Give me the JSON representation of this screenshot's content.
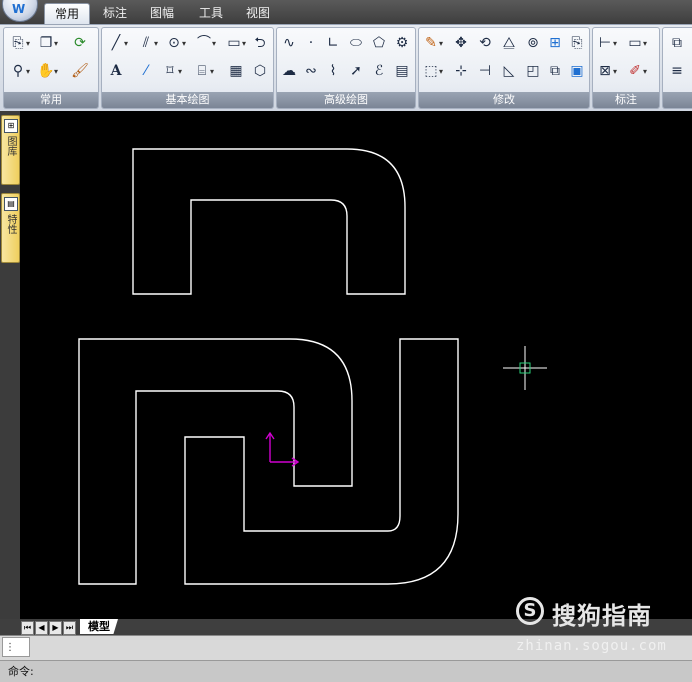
{
  "tabs": [
    "常用",
    "标注",
    "图幅",
    "工具",
    "视图"
  ],
  "active_tab": "常用",
  "ribbon": {
    "panels": [
      {
        "title": "常用"
      },
      {
        "title": "基本绘图"
      },
      {
        "title": "高级绘图"
      },
      {
        "title": "修改"
      },
      {
        "title": "标注"
      }
    ],
    "text_tool_label": "A"
  },
  "side_tabs": [
    "图库",
    "特性"
  ],
  "layout_tab": "模型",
  "command": {
    "grip": "⋮",
    "prompt": "命令:"
  },
  "watermark": {
    "logo": "S",
    "text": "搜狗指南",
    "url": "zhinan.sogou.com"
  },
  "colors": {
    "canvas": "#000000",
    "geometry": "#ffffff",
    "ucs": "#d000d0",
    "crosshair": "#ffffff",
    "pickbox": "#2bd07a"
  }
}
